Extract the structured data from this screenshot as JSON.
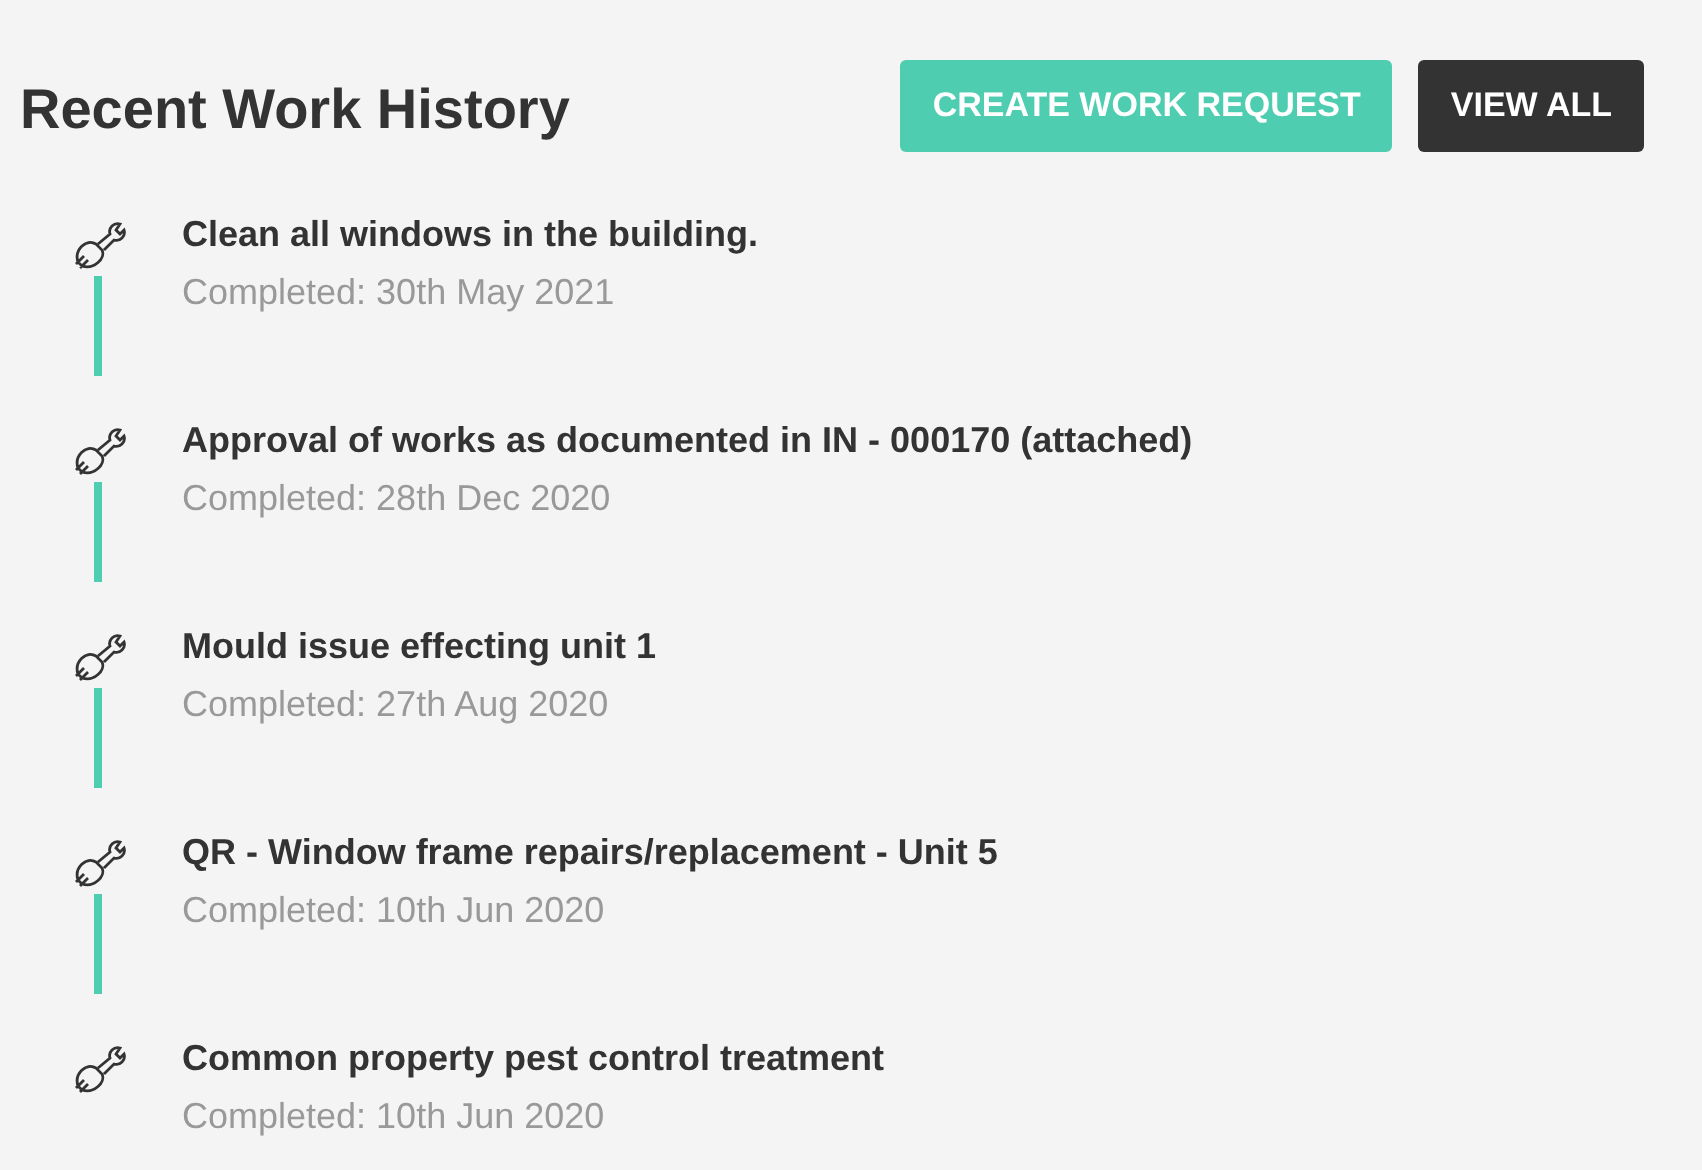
{
  "header": {
    "title": "Recent Work History",
    "buttons": [
      {
        "label": "CREATE WORK REQUEST",
        "kind": "primary"
      },
      {
        "label": "VIEW ALL",
        "kind": "dark"
      }
    ]
  },
  "items": [
    {
      "title": "Clean all windows in the building.",
      "date": "Completed: 30th May 2021"
    },
    {
      "title": "Approval of works as documented in IN - 000170 (attached)",
      "date": "Completed: 28th Dec 2020"
    },
    {
      "title": "Mould issue effecting unit 1",
      "date": "Completed: 27th Aug 2020"
    },
    {
      "title": "QR - Window frame repairs/replacement - Unit 5",
      "date": "Completed: 10th Jun 2020"
    },
    {
      "title": "Common property pest control treatment",
      "date": "Completed: 10th Jun 2020"
    }
  ]
}
